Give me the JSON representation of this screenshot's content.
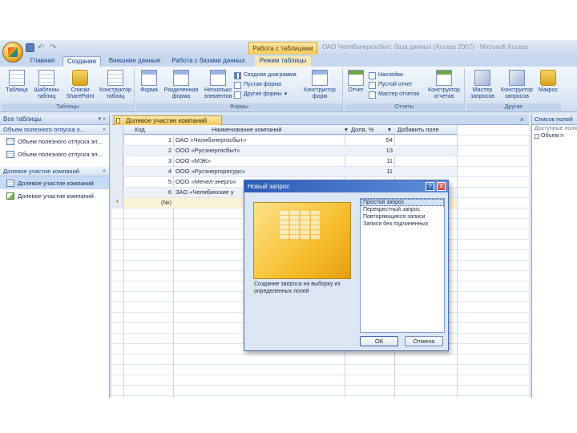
{
  "titlebar": {
    "context_title": "Работа с таблицами",
    "window_title": "ОАО Челябэнергосбыт: база данных (Access 2007) - Microsoft Access"
  },
  "tabs": [
    {
      "label": "Главная"
    },
    {
      "label": "Создание"
    },
    {
      "label": "Внешние данные"
    },
    {
      "label": "Работа с базами данных"
    },
    {
      "label": "Режим таблицы"
    }
  ],
  "ribbon": {
    "tables": {
      "group_label": "Таблицы",
      "buttons": [
        "Таблица",
        "Шаблоны таблиц",
        "Списки SharePoint",
        "Конструктор таблиц"
      ]
    },
    "forms": {
      "group_label": "Формы",
      "buttons": [
        "Форма",
        "Разделенная форма",
        "Несколько элементов"
      ],
      "small": [
        "Сводная диаграмма",
        "Пустая форма",
        "Другие формы"
      ],
      "designer": "Конструктор форм"
    },
    "reports": {
      "group_label": "Отчеты",
      "buttons": [
        "Отчет",
        "Конструктор отчетов"
      ],
      "small": [
        "Наклейки",
        "Пустой отчет",
        "Мастер отчетов"
      ]
    },
    "other": {
      "group_label": "Другие",
      "buttons": [
        "Мастер запросов",
        "Конструктор запросов",
        "Макрос"
      ]
    }
  },
  "nav": {
    "header": "Все таблицы",
    "groups": [
      {
        "title": "Объем полезного отпуска э...",
        "items": [
          {
            "label": "Объем полезного отпуска эл...",
            "icon": "table-icon"
          },
          {
            "label": "Объем полезного отпуска эл...",
            "icon": "table-icon"
          }
        ]
      },
      {
        "title": "Долевое участие компаний",
        "items": [
          {
            "label": "Долевое участие компаний",
            "icon": "table-icon"
          },
          {
            "label": "Долевое участие компаний",
            "icon": "query-icon"
          }
        ]
      }
    ]
  },
  "document": {
    "tab_label": "Долевое участие компаний",
    "columns": [
      "Код",
      "Наименование компаний",
      "Доля, %",
      "Добавить поле"
    ],
    "rows": [
      {
        "id": "1",
        "name": "ОАО «Челябэнергосбыт»",
        "share": "54"
      },
      {
        "id": "2",
        "name": "ООО «Русэнергосбыт»",
        "share": "13"
      },
      {
        "id": "3",
        "name": "ООО «МЭК»",
        "share": "11"
      },
      {
        "id": "4",
        "name": "ООО «Русэнергоресурс»",
        "share": "11"
      },
      {
        "id": "5",
        "name": "ООО «Мечел-энерго»",
        "share": "6"
      },
      {
        "id": "6",
        "name": "ЗАО «Челябинские у",
        "share": "5"
      }
    ],
    "new_row_marker": "*",
    "new_row_value": "(№)"
  },
  "right_pane": {
    "title": "Список полей",
    "subtitle": "Доступные поля",
    "item": "Объем п"
  },
  "dialog": {
    "title": "Новый запрос",
    "help_btn": "?",
    "close_btn": "X",
    "description": "Создание запроса на выборку из определенных полей",
    "options": [
      "Простой запрос",
      "Перекрестный запрос",
      "Повторяющиеся записи",
      "Записи без подчиненных"
    ],
    "ok_label": "ОК",
    "cancel_label": "Отмена"
  }
}
